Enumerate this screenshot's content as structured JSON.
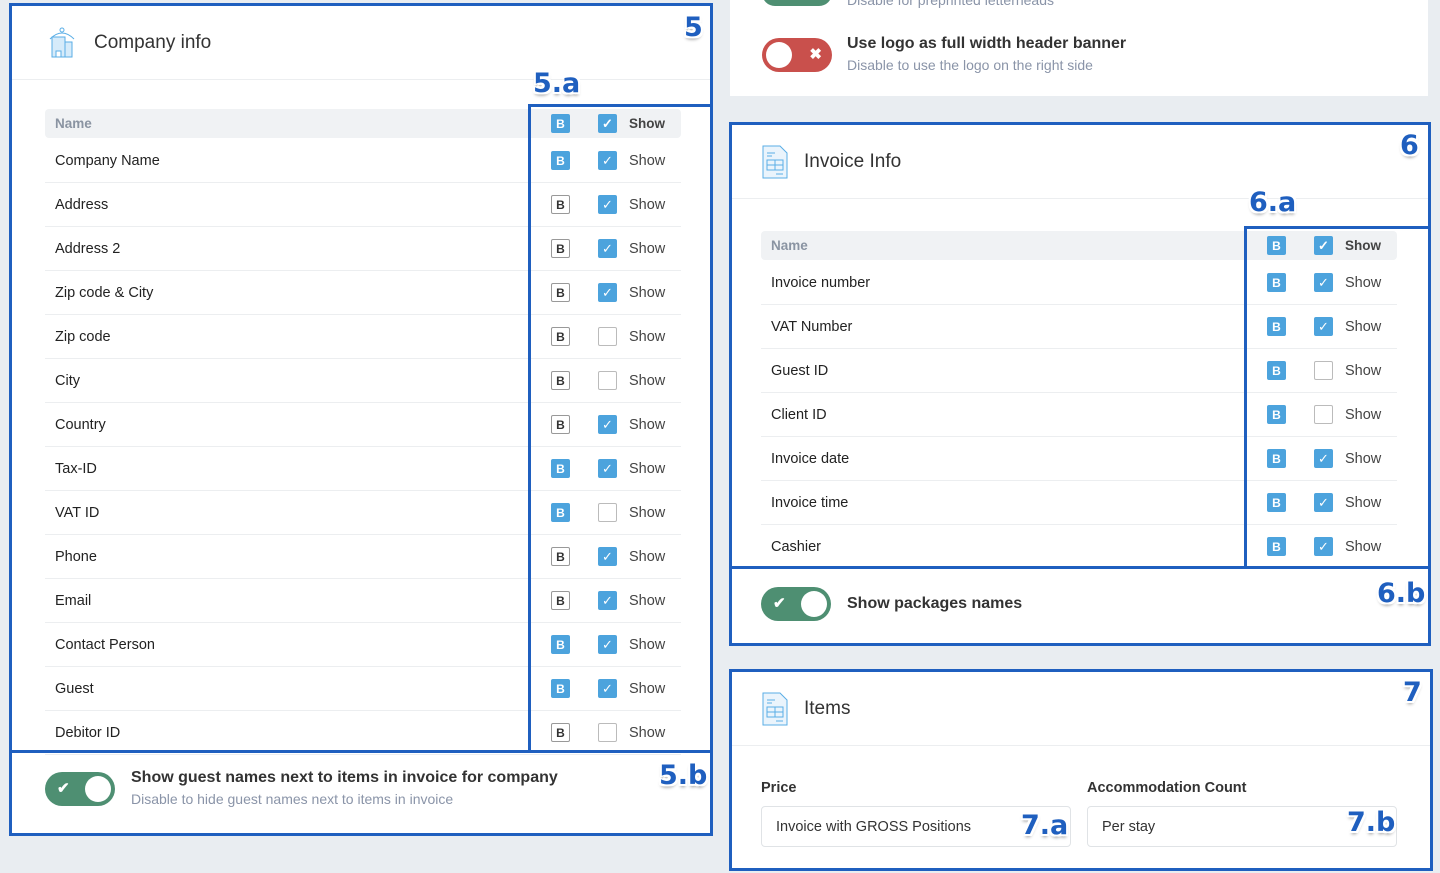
{
  "top_card": {
    "cut_subtitle": "Disable for preprinted letterheads",
    "logo_banner": {
      "title": "Use logo as full width header banner",
      "subtitle": "Disable to use the logo on the right side",
      "enabled": false
    }
  },
  "company": {
    "title": "Company info",
    "icon": "building-icon",
    "header": {
      "name": "Name",
      "show": "Show",
      "bold": true,
      "checked": true
    },
    "rows": [
      {
        "name": "Company Name",
        "bold": true,
        "checked": true
      },
      {
        "name": "Address",
        "bold": false,
        "checked": true
      },
      {
        "name": "Address 2",
        "bold": false,
        "checked": true
      },
      {
        "name": "Zip code & City",
        "bold": false,
        "checked": true
      },
      {
        "name": "Zip code",
        "bold": false,
        "checked": false
      },
      {
        "name": "City",
        "bold": false,
        "checked": false
      },
      {
        "name": "Country",
        "bold": false,
        "checked": true
      },
      {
        "name": "Tax-ID",
        "bold": true,
        "checked": true
      },
      {
        "name": "VAT ID",
        "bold": true,
        "checked": false
      },
      {
        "name": "Phone",
        "bold": false,
        "checked": true
      },
      {
        "name": "Email",
        "bold": false,
        "checked": true
      },
      {
        "name": "Contact Person",
        "bold": true,
        "checked": true
      },
      {
        "name": "Guest",
        "bold": true,
        "checked": true
      },
      {
        "name": "Debitor ID",
        "bold": false,
        "checked": false
      }
    ],
    "guest_names": {
      "title": "Show guest names next to items in invoice for company",
      "subtitle": "Disable to hide guest names next to items in invoice",
      "enabled": true
    }
  },
  "invoice": {
    "title": "Invoice Info",
    "icon": "document-icon",
    "header": {
      "name": "Name",
      "show": "Show",
      "bold": true,
      "checked": true
    },
    "rows": [
      {
        "name": "Invoice number",
        "bold": true,
        "checked": true
      },
      {
        "name": "VAT Number",
        "bold": true,
        "checked": true
      },
      {
        "name": "Guest ID",
        "bold": true,
        "checked": false
      },
      {
        "name": "Client ID",
        "bold": true,
        "checked": false
      },
      {
        "name": "Invoice date",
        "bold": true,
        "checked": true
      },
      {
        "name": "Invoice time",
        "bold": true,
        "checked": true
      },
      {
        "name": "Cashier",
        "bold": true,
        "checked": true
      }
    ],
    "packages": {
      "title": "Show packages names",
      "enabled": true
    }
  },
  "items": {
    "title": "Items",
    "icon": "document-icon",
    "price_label": "Price",
    "price_value": "Invoice with GROSS Positions",
    "acc_label": "Accommodation Count",
    "acc_value": "Per stay"
  },
  "bold_letter": "B",
  "show_label": "Show",
  "annotations": {
    "a5": "5",
    "a5a": "5.a",
    "a5b": "5.b",
    "a6": "6",
    "a6a": "6.a",
    "a6b": "6.b",
    "a7": "7",
    "a7a": "7.a",
    "a7b": "7.b"
  },
  "colors": {
    "annotation": "#1f5fbf",
    "accent": "#4ca3dd",
    "toggle_on": "#4e8f72",
    "toggle_off": "#c9504c"
  }
}
